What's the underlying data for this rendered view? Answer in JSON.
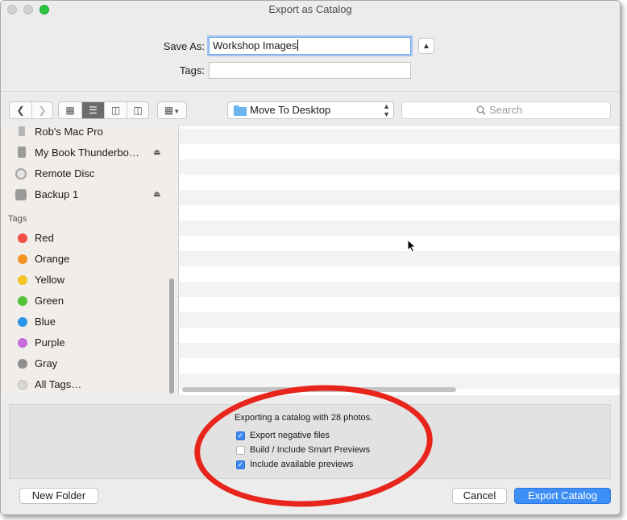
{
  "window": {
    "title": "Export as Catalog"
  },
  "form": {
    "save_as_label": "Save As:",
    "save_as_value": "Workshop Images",
    "tags_label": "Tags:",
    "tags_value": ""
  },
  "toolbar": {
    "location": "Move To Desktop",
    "search_placeholder": "Search"
  },
  "sidebar": {
    "devices": [
      {
        "label": "Rob's Mac Pro",
        "icon": "computer-icon",
        "eject": false
      },
      {
        "label": "My Book Thunderbo…",
        "icon": "external-drive-icon",
        "eject": true
      },
      {
        "label": "Remote Disc",
        "icon": "disc-icon",
        "eject": false
      },
      {
        "label": "Backup 1",
        "icon": "time-machine-icon",
        "eject": true
      }
    ],
    "tags_heading": "Tags",
    "tags": [
      {
        "label": "Red",
        "color": "#f14f45"
      },
      {
        "label": "Orange",
        "color": "#f39322"
      },
      {
        "label": "Yellow",
        "color": "#f4c426"
      },
      {
        "label": "Green",
        "color": "#55c13a"
      },
      {
        "label": "Blue",
        "color": "#2b96e8"
      },
      {
        "label": "Purple",
        "color": "#c56edb"
      },
      {
        "label": "Gray",
        "color": "#8e8e8e"
      },
      {
        "label": "All Tags…",
        "color": "#d8d8d8"
      }
    ]
  },
  "options": {
    "info": "Exporting a catalog with 28 photos.",
    "checkboxes": [
      {
        "label": "Export negative files",
        "checked": true
      },
      {
        "label": "Build / Include Smart Previews",
        "checked": false
      },
      {
        "label": "Include available previews",
        "checked": true
      }
    ]
  },
  "buttons": {
    "new_folder": "New Folder",
    "cancel": "Cancel",
    "export": "Export Catalog"
  },
  "annotation_color": "#e8251c"
}
